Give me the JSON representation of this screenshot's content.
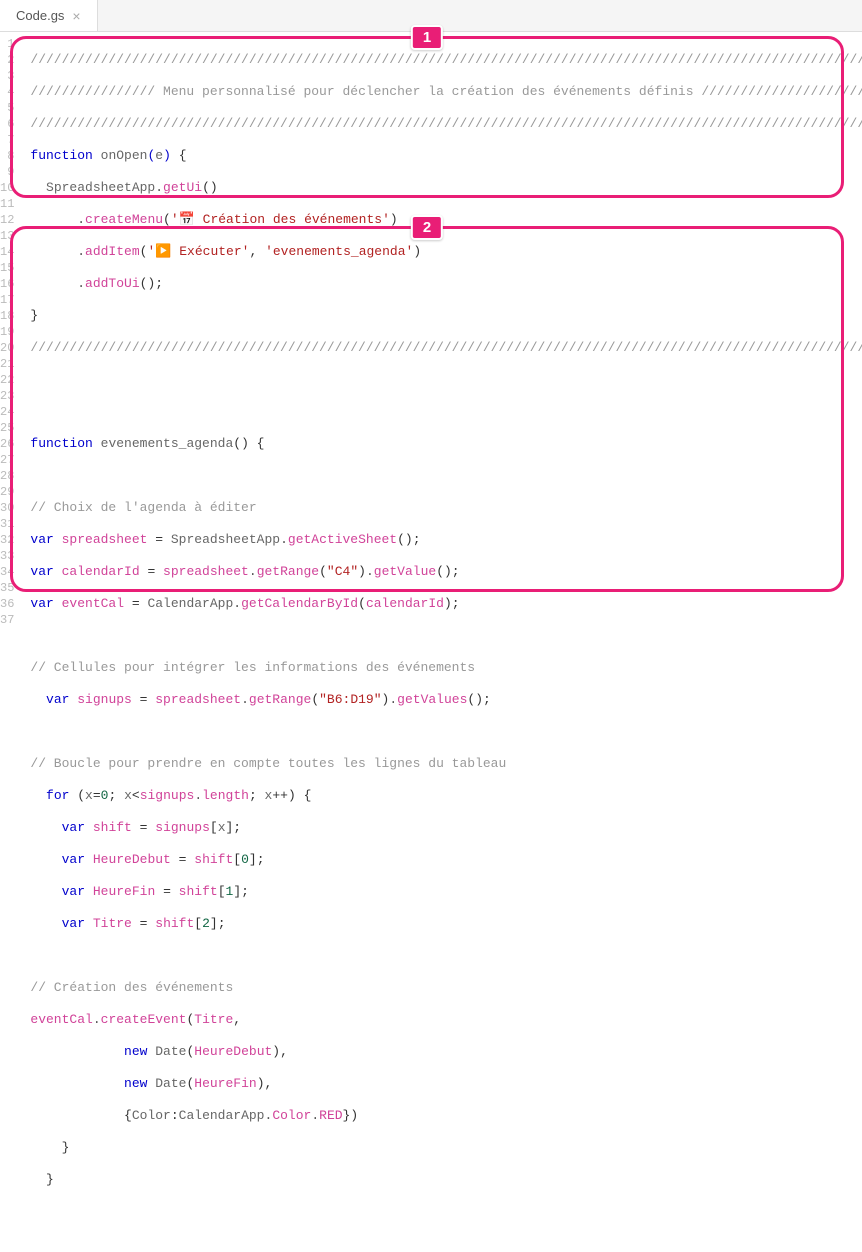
{
  "tab": {
    "name": "Code.gs"
  },
  "lineCount": 37,
  "annotations": {
    "one": "1",
    "two": "2"
  },
  "code": {
    "l1": "/////////////////////////////////////////////////////////////////////////////////////////////////////////////",
    "l2a": "//////////////// ",
    "l2b": "Menu personnalisé pour déclencher la création des événements définis ",
    "l2c": "//////////////////////",
    "l3": "/////////////////////////////////////////////////////////////////////////////////////////////////////////////",
    "l4_fn": "function",
    "l4_name": "onOpen",
    "l4_p": "(",
    "l4_e": "e",
    "l4_cp": ")",
    "l4_b": " {",
    "l5_obj": "SpreadsheetApp",
    "l5_m": "getUi",
    "l5_p": "()",
    "l6_m": "createMenu",
    "l6_s": "'📅 Création des événements'",
    "l7_m": "addItem",
    "l7_s1": "'▶️ Exécuter'",
    "l7_s2": "'evenements_agenda'",
    "l8_m": "addToUi",
    "l8_p": "();",
    "l9_b": "}",
    "l10": "/////////////////////////////////////////////////////////////////////////////////////////////////////////////",
    "l13_fn": "function",
    "l13_name": "evenements_agenda",
    "l13_rest": "() {",
    "l15": "// Choix de l'agenda à éditer",
    "l16_var": "var",
    "l16_id": "spreadsheet",
    "l16_eq": " = ",
    "l16_obj": "SpreadsheetApp",
    "l16_m": "getActiveSheet",
    "l16_p": "();",
    "l17_var": "var",
    "l17_id": "calendarId",
    "l17_eq": " = ",
    "l17_obj": "spreadsheet",
    "l17_m": "getRange",
    "l17_s": "\"C4\"",
    "l17_m2": "getValue",
    "l17_p": "();",
    "l18_var": "var",
    "l18_id": "eventCal",
    "l18_eq": " = ",
    "l18_obj": "CalendarApp",
    "l18_m": "getCalendarById",
    "l18_arg": "calendarId",
    "l18_p": ");",
    "l20": "// Cellules pour intégrer les informations des événements",
    "l21_var": "var",
    "l21_id": "signups",
    "l21_eq": " = ",
    "l21_obj": "spreadsheet",
    "l21_m": "getRange",
    "l21_s": "\"B6:D19\"",
    "l21_m2": "getValues",
    "l21_p": "();",
    "l23": "// Boucle pour prendre en compte toutes les lignes du tableau",
    "l24_for": "for",
    "l24_o": " (",
    "l24_x": "x",
    "l24_eq": "=",
    "l24_z": "0",
    "l24_sc": "; ",
    "l24_x2": "x",
    "l24_lt": "<",
    "l24_sig": "signups",
    "l24_len": "length",
    "l24_sc2": "; ",
    "l24_x3": "x",
    "l24_pp": "++) {",
    "l25_var": "var",
    "l25_id": "shift",
    "l25_eq": " = ",
    "l25_sig": "signups",
    "l25_br": "[",
    "l25_x": "x",
    "l25_cb": "];",
    "l26_var": "var",
    "l26_id": "HeureDebut",
    "l26_eq": " = ",
    "l26_sh": "shift",
    "l26_br": "[",
    "l26_n": "0",
    "l26_cb": "];",
    "l27_var": "var",
    "l27_id": "HeureFin",
    "l27_eq": " = ",
    "l27_sh": "shift",
    "l27_br": "[",
    "l27_n": "1",
    "l27_cb": "];",
    "l28_var": "var",
    "l28_id": "Titre",
    "l28_eq": " = ",
    "l28_sh": "shift",
    "l28_br": "[",
    "l28_n": "2",
    "l28_cb": "];",
    "l30": "// Création des événements",
    "l31_obj": "eventCal",
    "l31_m": "createEvent",
    "l31_arg": "Titre",
    "l31_c": ",",
    "l32_new": "new",
    "l32_d": "Date",
    "l32_arg": "HeureDebut",
    "l32_c": "),",
    "l33_new": "new",
    "l33_d": "Date",
    "l33_arg": "HeureFin",
    "l33_c": "),",
    "l34_o": "{",
    "l34_k": "Color",
    "l34_col": ":",
    "l34_ca": "CalendarApp",
    "l34_c2": "Color",
    "l34_r": "RED",
    "l34_cl": "})",
    "l35_b": "}",
    "l36_b": "}"
  }
}
